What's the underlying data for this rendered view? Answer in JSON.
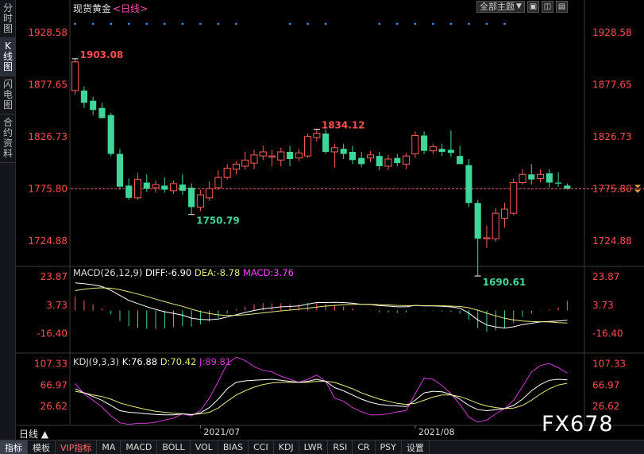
{
  "header": {
    "instrument": "现货黄金",
    "period_badge": "<日线>"
  },
  "controls": {
    "main_indicator": "全部主题",
    "dropdown_arrow": "▼",
    "icons": [
      "layout-icon",
      "expand-icon",
      "settings-icon"
    ]
  },
  "sidebar": [
    {
      "label": "分时图",
      "chars": [
        "分",
        "时",
        "图"
      ],
      "active": false
    },
    {
      "label": "K线图",
      "chars": [
        "K",
        "线",
        "图"
      ],
      "active": true
    },
    {
      "label": "闪电图",
      "chars": [
        "闪",
        "电",
        "图"
      ],
      "active": false
    },
    {
      "label": "合约资料",
      "chars": [
        "合",
        "约",
        "资",
        "料"
      ],
      "active": false
    }
  ],
  "macd_label": {
    "name": "MACD(26,12,9)",
    "diff": "DIFF:-6.90",
    "dea": "DEA:-8.78",
    "macd": "MACD:3.76"
  },
  "kdj_label": {
    "name": "KDJ(9,3,3)",
    "k": "K:76.88",
    "d": "D:70.42",
    "j": "J:89.81"
  },
  "period_select": "日线 ▲",
  "bottom_tabs": [
    "指标",
    "模板",
    "VIP指标",
    "MA",
    "MACD",
    "BOLL",
    "VOL",
    "BIAS",
    "CCI",
    "KDJ",
    "LWR",
    "RSI",
    "CR",
    "PSY",
    "设置"
  ],
  "watermark": "FX678",
  "colors": {
    "up": "#ff5a5a",
    "down": "#3fd69a",
    "diff": "#ffffff",
    "dea": "#e8e87a",
    "macd_label": "#ff44ff",
    "k": "#ffffff",
    "d": "#e8e87a",
    "j": "#d23ad2",
    "axis_text": "#ff4d4d",
    "dots": "#3a8ee6"
  },
  "chart_data": [
    {
      "type": "candlestick",
      "title": "现货黄金 <日线>",
      "y_ticks": [
        "1928.58",
        "1877.65",
        "1826.73",
        "1775.80",
        "1724.88"
      ],
      "ylim": [
        1700,
        1945
      ],
      "current_price_line": 1775.8,
      "x_tick_labels": [
        "2021/07",
        "2021/08"
      ],
      "annotations": [
        {
          "text": "1903.08",
          "value": 1903.08,
          "bar": 0,
          "kind": "high"
        },
        {
          "text": "1834.12",
          "value": 1834.12,
          "bar": 27,
          "kind": "high"
        },
        {
          "text": "1750.79",
          "value": 1750.79,
          "bar": 13,
          "kind": "low"
        },
        {
          "text": "1690.61",
          "value": 1690.61,
          "bar": 45,
          "kind": "low"
        }
      ],
      "candles": [
        {
          "o": 1872,
          "h": 1903.08,
          "l": 1868,
          "c": 1900
        },
        {
          "o": 1872,
          "h": 1876,
          "l": 1855,
          "c": 1860
        },
        {
          "o": 1862,
          "h": 1866,
          "l": 1848,
          "c": 1853
        },
        {
          "o": 1855,
          "h": 1860,
          "l": 1845,
          "c": 1845
        },
        {
          "o": 1848,
          "h": 1850,
          "l": 1808,
          "c": 1810
        },
        {
          "o": 1810,
          "h": 1815,
          "l": 1775,
          "c": 1778
        },
        {
          "o": 1779,
          "h": 1786,
          "l": 1765,
          "c": 1767
        },
        {
          "o": 1767,
          "h": 1791,
          "l": 1765,
          "c": 1785
        },
        {
          "o": 1782,
          "h": 1790,
          "l": 1773,
          "c": 1776
        },
        {
          "o": 1777,
          "h": 1784,
          "l": 1772,
          "c": 1780
        },
        {
          "o": 1779,
          "h": 1787,
          "l": 1772,
          "c": 1775
        },
        {
          "o": 1774,
          "h": 1784,
          "l": 1771,
          "c": 1781
        },
        {
          "o": 1780,
          "h": 1790,
          "l": 1770,
          "c": 1774
        },
        {
          "o": 1777,
          "h": 1781,
          "l": 1750.79,
          "c": 1758
        },
        {
          "o": 1758,
          "h": 1775,
          "l": 1754,
          "c": 1770
        },
        {
          "o": 1767,
          "h": 1783,
          "l": 1764,
          "c": 1776
        },
        {
          "o": 1777,
          "h": 1794,
          "l": 1775,
          "c": 1787
        },
        {
          "o": 1787,
          "h": 1800,
          "l": 1785,
          "c": 1796
        },
        {
          "o": 1795,
          "h": 1803,
          "l": 1790,
          "c": 1800
        },
        {
          "o": 1798,
          "h": 1812,
          "l": 1795,
          "c": 1804
        },
        {
          "o": 1801,
          "h": 1814,
          "l": 1795,
          "c": 1809
        },
        {
          "o": 1808,
          "h": 1818,
          "l": 1804,
          "c": 1812
        },
        {
          "o": 1807,
          "h": 1814,
          "l": 1798,
          "c": 1808
        },
        {
          "o": 1804,
          "h": 1816,
          "l": 1798,
          "c": 1812
        },
        {
          "o": 1812,
          "h": 1818,
          "l": 1798,
          "c": 1805
        },
        {
          "o": 1806,
          "h": 1815,
          "l": 1803,
          "c": 1811
        },
        {
          "o": 1808,
          "h": 1830,
          "l": 1806,
          "c": 1827
        },
        {
          "o": 1826,
          "h": 1834.12,
          "l": 1822,
          "c": 1830
        },
        {
          "o": 1830,
          "h": 1834,
          "l": 1810,
          "c": 1812
        },
        {
          "o": 1812,
          "h": 1820,
          "l": 1797,
          "c": 1816
        },
        {
          "o": 1815,
          "h": 1820,
          "l": 1805,
          "c": 1810
        },
        {
          "o": 1812,
          "h": 1818,
          "l": 1800,
          "c": 1804
        },
        {
          "o": 1806,
          "h": 1812,
          "l": 1797,
          "c": 1800
        },
        {
          "o": 1806,
          "h": 1813,
          "l": 1802,
          "c": 1809
        },
        {
          "o": 1808,
          "h": 1812,
          "l": 1794,
          "c": 1798
        },
        {
          "o": 1798,
          "h": 1809,
          "l": 1794,
          "c": 1805
        },
        {
          "o": 1806,
          "h": 1810,
          "l": 1798,
          "c": 1801
        },
        {
          "o": 1800,
          "h": 1811,
          "l": 1795,
          "c": 1808
        },
        {
          "o": 1810,
          "h": 1832,
          "l": 1806,
          "c": 1828
        },
        {
          "o": 1828,
          "h": 1832,
          "l": 1810,
          "c": 1813
        },
        {
          "o": 1813,
          "h": 1820,
          "l": 1810,
          "c": 1817
        },
        {
          "o": 1815,
          "h": 1820,
          "l": 1808,
          "c": 1812
        },
        {
          "o": 1814,
          "h": 1833,
          "l": 1807,
          "c": 1811
        },
        {
          "o": 1808,
          "h": 1818,
          "l": 1800,
          "c": 1800
        },
        {
          "o": 1799,
          "h": 1805,
          "l": 1758,
          "c": 1762
        },
        {
          "o": 1762,
          "h": 1765,
          "l": 1690.61,
          "c": 1727
        },
        {
          "o": 1727,
          "h": 1740,
          "l": 1718,
          "c": 1728
        },
        {
          "o": 1727,
          "h": 1757,
          "l": 1724,
          "c": 1752
        },
        {
          "o": 1747,
          "h": 1762,
          "l": 1738,
          "c": 1756
        },
        {
          "o": 1752,
          "h": 1786,
          "l": 1750,
          "c": 1782
        },
        {
          "o": 1782,
          "h": 1795,
          "l": 1780,
          "c": 1790
        },
        {
          "o": 1790,
          "h": 1800,
          "l": 1780,
          "c": 1785
        },
        {
          "o": 1786,
          "h": 1795,
          "l": 1782,
          "c": 1790
        },
        {
          "o": 1791,
          "h": 1795,
          "l": 1777,
          "c": 1782
        },
        {
          "o": 1782,
          "h": 1792,
          "l": 1778,
          "c": 1781
        },
        {
          "o": 1779,
          "h": 1781,
          "l": 1775,
          "c": 1776
        }
      ]
    },
    {
      "type": "macd",
      "y_ticks": [
        "23.87",
        "3.73",
        "-16.40"
      ],
      "ylim": [
        -30,
        30
      ],
      "series": [
        {
          "name": "DIFF",
          "values": [
            19.5,
            18.9,
            18.1,
            16.9,
            14.2,
            10.6,
            7.1,
            4.9,
            2.7,
            0.8,
            -0.9,
            -2.0,
            -3.3,
            -5.4,
            -6.3,
            -6.5,
            -6.0,
            -4.6,
            -3.0,
            -1.4,
            0.0,
            1.2,
            1.8,
            2.6,
            2.8,
            3.2,
            4.5,
            5.6,
            5.6,
            5.8,
            5.6,
            5.1,
            4.4,
            4.2,
            3.4,
            3.1,
            2.6,
            2.6,
            3.6,
            3.2,
            3.2,
            2.9,
            2.5,
            1.6,
            -1.8,
            -6.7,
            -10.2,
            -11.6,
            -12.4,
            -11.5,
            -9.9,
            -9.0,
            -8.0,
            -7.7,
            -7.4,
            -6.9
          ]
        },
        {
          "name": "DEA",
          "values": [
            14.0,
            15.0,
            15.7,
            16.0,
            15.7,
            14.7,
            13.2,
            11.6,
            9.9,
            8.0,
            6.2,
            4.5,
            2.9,
            0.9,
            -0.8,
            -2.2,
            -3.1,
            -3.5,
            -3.4,
            -3.0,
            -2.4,
            -1.7,
            -1.0,
            -0.3,
            0.3,
            0.9,
            1.6,
            2.4,
            3.1,
            3.6,
            4.0,
            4.3,
            4.3,
            4.3,
            4.1,
            3.9,
            3.6,
            3.4,
            3.5,
            3.4,
            3.4,
            3.3,
            3.1,
            2.8,
            1.9,
            0.2,
            -1.9,
            -3.8,
            -5.5,
            -6.7,
            -7.4,
            -7.8,
            -7.9,
            -8.1,
            -8.5,
            -8.78
          ]
        },
        {
          "name": "MACD",
          "values": [
            5.5,
            3.9,
            2.4,
            0.9,
            -1.5,
            -4.1,
            -6.1,
            -6.7,
            -7.2,
            -7.2,
            -7.1,
            -6.5,
            -6.2,
            -6.3,
            -5.5,
            -4.3,
            -2.9,
            -1.1,
            0.4,
            1.6,
            2.4,
            2.9,
            2.8,
            2.9,
            2.5,
            2.3,
            2.9,
            3.2,
            2.5,
            2.2,
            1.6,
            0.8,
            0.1,
            -0.1,
            -0.7,
            -0.8,
            -1.0,
            -0.8,
            0.1,
            -0.2,
            -0.2,
            -0.4,
            -0.6,
            -1.2,
            -3.7,
            -6.9,
            -8.3,
            -7.8,
            -6.9,
            -4.8,
            -2.5,
            -1.2,
            -0.1,
            0.4,
            1.1,
            3.76
          ]
        }
      ]
    },
    {
      "type": "line",
      "y_ticks": [
        "107.33",
        "66.97",
        "26.62"
      ],
      "ylim": [
        -10,
        125
      ],
      "series": [
        {
          "name": "K",
          "values": [
            60,
            52,
            45,
            38,
            28,
            18,
            15,
            14,
            12,
            11,
            10,
            10,
            12,
            10,
            14,
            24,
            40,
            60,
            72,
            75,
            76,
            77,
            78,
            76,
            74,
            72,
            74,
            78,
            74,
            62,
            56,
            48,
            40,
            34,
            30,
            28,
            27,
            26,
            38,
            52,
            55,
            54,
            49,
            40,
            28,
            20,
            18,
            20,
            22,
            28,
            40,
            56,
            68,
            76,
            78,
            76.88
          ]
        },
        {
          "name": "D",
          "values": [
            55,
            52,
            48,
            45,
            40,
            33,
            28,
            24,
            20,
            17,
            15,
            13,
            12,
            11,
            12,
            15,
            23,
            36,
            48,
            56,
            63,
            68,
            71,
            72,
            72,
            72,
            72,
            74,
            74,
            72,
            66,
            60,
            52,
            46,
            40,
            36,
            32,
            30,
            32,
            38,
            44,
            48,
            48,
            45,
            39,
            32,
            27,
            24,
            22,
            23,
            28,
            38,
            50,
            60,
            67,
            70.42
          ]
        },
        {
          "name": "J",
          "values": [
            70,
            50,
            38,
            25,
            8,
            -5,
            -8,
            -6,
            -6,
            -4,
            0,
            4,
            12,
            8,
            18,
            42,
            74,
            108,
            120,
            114,
            102,
            95,
            92,
            84,
            78,
            72,
            78,
            86,
            74,
            42,
            36,
            24,
            16,
            10,
            10,
            12,
            16,
            18,
            50,
            80,
            78,
            66,
            50,
            30,
            6,
            -4,
            0,
            12,
            22,
            38,
            64,
            92,
            104,
            108,
            100,
            89.81
          ]
        }
      ]
    }
  ]
}
